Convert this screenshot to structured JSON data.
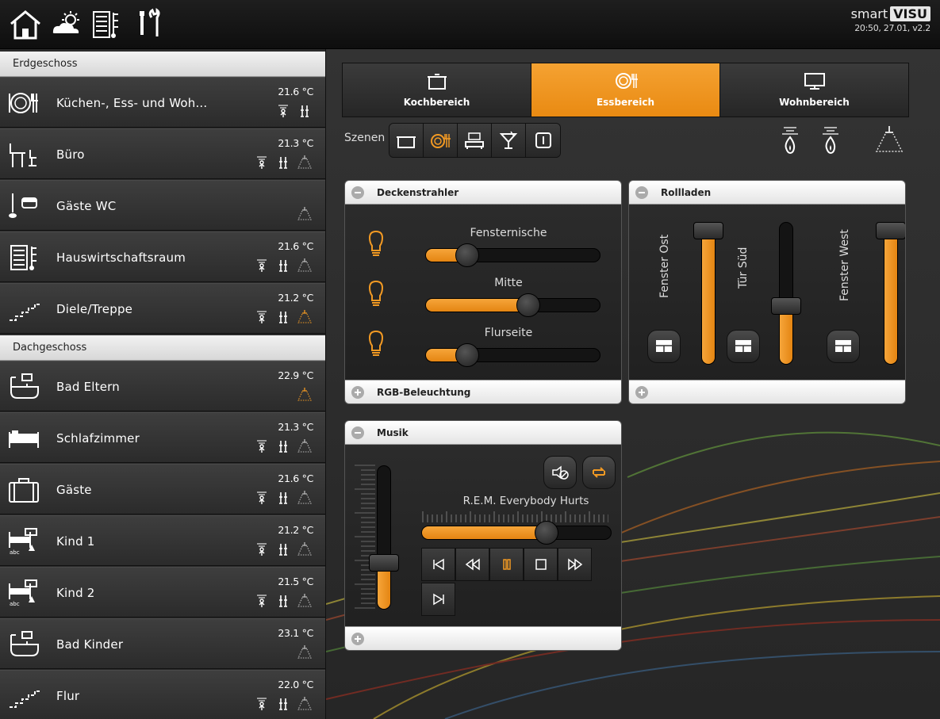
{
  "header": {
    "icons": [
      "home-icon",
      "weather-icon",
      "house-floors-icon",
      "tools-icon"
    ],
    "brand_smart": "smart",
    "brand_visu": "VISU",
    "status": "20:50, 27.01, v2.2"
  },
  "sidebar": {
    "sections": [
      {
        "label": "Erdgeschoss"
      },
      {
        "label": "Dachgeschoss"
      }
    ],
    "rooms": [
      {
        "name": "Küchen-, Ess- und Woh...",
        "temp": "21.6 °C",
        "icon": "kitchen-dining-icon",
        "status": [
          "motion-icon",
          "heating-icon"
        ]
      },
      {
        "name": "Büro",
        "temp": "21.3 °C",
        "icon": "office-desk-icon",
        "status": [
          "motion-icon",
          "heating-icon",
          "ceiling-light-icon"
        ]
      },
      {
        "name": "Gäste WC",
        "temp": "",
        "icon": "toilet-icon",
        "status": [
          "ceiling-light-icon"
        ]
      },
      {
        "name": "Hauswirtschaftsraum",
        "temp": "21.6 °C",
        "icon": "utility-room-icon",
        "status": [
          "motion-icon",
          "heating-icon",
          "ceiling-light-icon"
        ]
      },
      {
        "name": "Diele/Treppe",
        "temp": "21.2 °C",
        "icon": "stairs-icon",
        "status": [
          "motion-icon",
          "heating-icon",
          "ceiling-light-on-icon"
        ]
      },
      {
        "name": "Bad Eltern",
        "temp": "22.9 °C",
        "icon": "bath-icon",
        "status": [
          "ceiling-light-on-icon"
        ]
      },
      {
        "name": "Schlafzimmer",
        "temp": "21.3 °C",
        "icon": "bed-icon",
        "status": [
          "motion-icon",
          "heating-icon",
          "ceiling-light-icon"
        ]
      },
      {
        "name": "Gäste",
        "temp": "21.6 °C",
        "icon": "suitcase-icon",
        "status": [
          "motion-icon",
          "heating-icon",
          "ceiling-light-icon"
        ]
      },
      {
        "name": "Kind 1",
        "temp": "21.2 °C",
        "icon": "child-room-icon",
        "status": [
          "motion-icon",
          "heating-icon",
          "ceiling-light-icon"
        ]
      },
      {
        "name": "Kind 2",
        "temp": "21.5 °C",
        "icon": "child-room-icon",
        "status": [
          "motion-icon",
          "heating-icon",
          "ceiling-light-icon"
        ]
      },
      {
        "name": "Bad Kinder",
        "temp": "23.1 °C",
        "icon": "bath-icon",
        "status": [
          "ceiling-light-icon"
        ]
      },
      {
        "name": "Flur",
        "temp": "22.0 °C",
        "icon": "stairs-icon",
        "status": [
          "motion-icon",
          "heating-icon",
          "ceiling-light-icon"
        ]
      }
    ]
  },
  "tabs": [
    {
      "label": "Kochbereich",
      "icon": "cooking-pot-icon",
      "active": false
    },
    {
      "label": "Essbereich",
      "icon": "dining-icon",
      "active": true
    },
    {
      "label": "Wohnbereich",
      "icon": "tv-icon",
      "active": false
    }
  ],
  "scenes": {
    "label": "Szenen",
    "buttons": [
      "cooking-pot-icon",
      "dining-icon",
      "sofa-icon",
      "cocktail-icon",
      "off-icon"
    ]
  },
  "deckenstrahler": {
    "title": "Deckenstrahler",
    "sliders": [
      {
        "label": "Fensternische",
        "value_pct": 20
      },
      {
        "label": "Mitte",
        "value_pct": 60
      },
      {
        "label": "Flurseite",
        "value_pct": 20
      }
    ]
  },
  "rgb": {
    "title": "RGB-Beleuchtung"
  },
  "rollladen": {
    "title": "Rollladen",
    "shutters": [
      {
        "label": "Fenster Ost",
        "value_pct": 100
      },
      {
        "label": "Tür Süd",
        "value_pct": 40
      },
      {
        "label": "Fenster West",
        "value_pct": 100
      }
    ]
  },
  "musik": {
    "title": "Musik",
    "track": "R.E.M.   Everybody Hurts",
    "volume_pct": 30,
    "progress_pct": 68
  },
  "colors": {
    "accent": "#f39a23",
    "panel": "#2b2b2b"
  }
}
